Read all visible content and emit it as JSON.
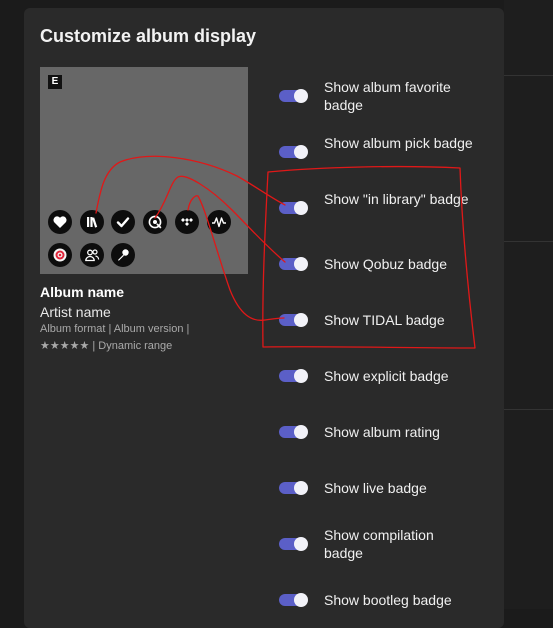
{
  "dialog": {
    "title": "Customize album display"
  },
  "preview": {
    "explicit_badge": "E",
    "album_name": "Album name",
    "artist_name": "Artist name",
    "meta_line1": "Album format | Album version |",
    "rating_stars": "★★★★★",
    "meta_line2_suffix": " | Dynamic range"
  },
  "badges": [
    "heart-icon",
    "library-icon",
    "check-icon",
    "qobuz-icon",
    "tidal-icon",
    "audio-wave-icon",
    "live-icon",
    "users-icon",
    "microphone-icon"
  ],
  "options": [
    {
      "label": "Show album favorite badge",
      "on": true
    },
    {
      "label": "Show album pick badge",
      "on": true
    },
    {
      "label": "Show \"in library\" badge",
      "on": true
    },
    {
      "label": "Show Qobuz badge",
      "on": true
    },
    {
      "label": "Show TIDAL badge",
      "on": true
    },
    {
      "label": "Show explicit badge",
      "on": true
    },
    {
      "label": "Show album rating",
      "on": true
    },
    {
      "label": "Show live badge",
      "on": true
    },
    {
      "label": "Show compilation badge",
      "on": true
    },
    {
      "label": "Show bootleg badge",
      "on": true
    }
  ],
  "colors": {
    "toggle_on": "#5b5fc7",
    "annotation": "#e01818",
    "panel": "#2a2a2a"
  }
}
